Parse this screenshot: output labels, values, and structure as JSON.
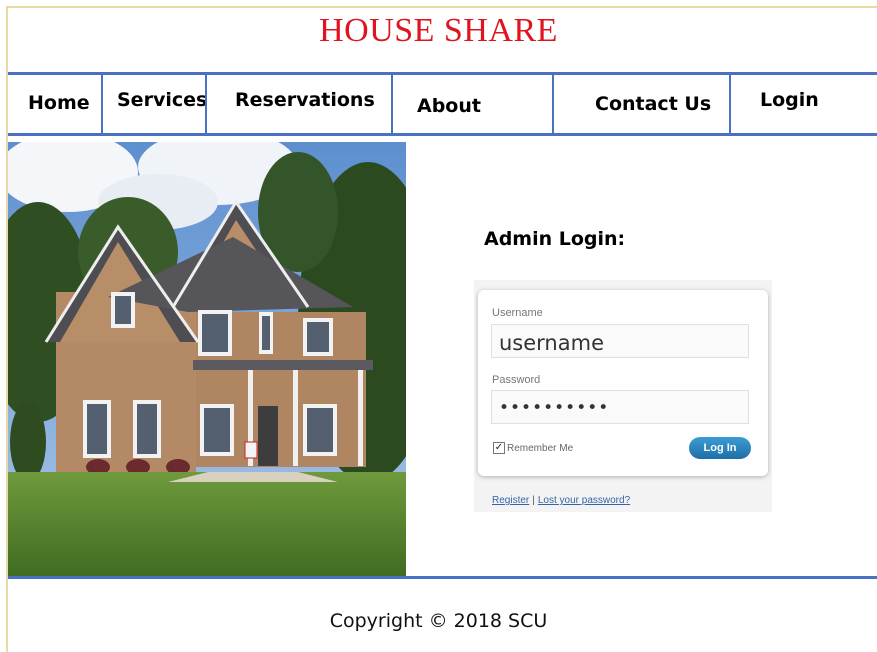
{
  "site": {
    "title": "HOUSE SHARE"
  },
  "nav": {
    "items": [
      {
        "label": "Home"
      },
      {
        "label": "Services"
      },
      {
        "label": "Reservations"
      },
      {
        "label": "About"
      },
      {
        "label": "Contact Us"
      },
      {
        "label": "Login"
      }
    ]
  },
  "login": {
    "heading": "Admin Login:",
    "username_label": "Username",
    "username_value": "username",
    "password_label": "Password",
    "password_value": "••••••••••",
    "remember_label": "Remember Me",
    "remember_checked": true,
    "button_label": "Log In",
    "register_link": "Register",
    "separator": "|",
    "lost_password_link": "Lost your password?"
  },
  "footer": {
    "copyright": "Copyright © 2018 SCU"
  },
  "colors": {
    "title": "#e0141e",
    "nav_border": "#4a72c4",
    "button": "#2a84c0",
    "link": "#3465a4"
  }
}
